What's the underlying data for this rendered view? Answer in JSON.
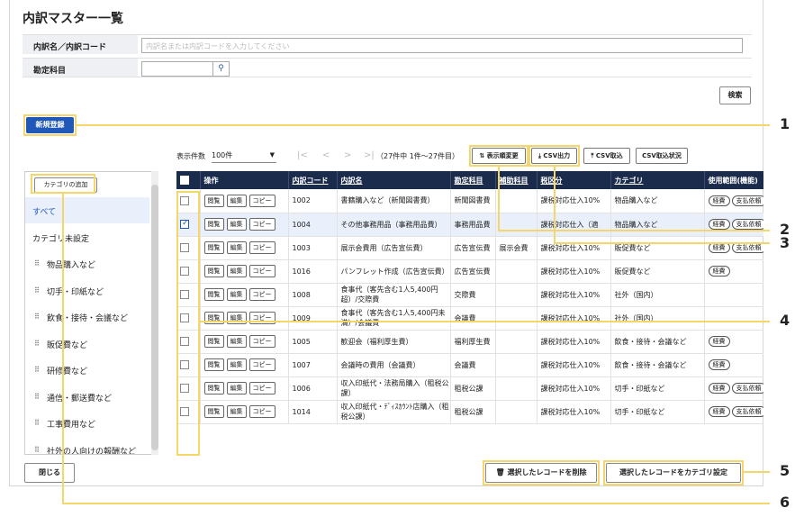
{
  "page": {
    "title": "内訳マスター一覧"
  },
  "filters": {
    "name_label": "内訳名／内訳コード",
    "name_placeholder": "内訳名または内訳コードを入力してください",
    "account_label": "勘定科目",
    "search_button": "検索"
  },
  "new_button": "新規登録",
  "toolbar": {
    "count_label": "表示件数",
    "count_value": "100件",
    "pager_first": "|<",
    "pager_prev": "<",
    "pager_next": ">",
    "pager_last": ">|",
    "range_text": "（27件中 1件～27件目）",
    "reorder_button": "表示順変更",
    "csv_export": "CSV出力",
    "csv_import": "CSV取込",
    "csv_status": "CSV取込状況"
  },
  "categories": {
    "add_button": "カテゴリの追加",
    "items": [
      {
        "label": "すべて",
        "active": true,
        "grip": false
      },
      {
        "label": "カテゴリ未設定",
        "active": false,
        "grip": false
      },
      {
        "label": "物品購入など",
        "active": false,
        "grip": true
      },
      {
        "label": "切手・印紙など",
        "active": false,
        "grip": true
      },
      {
        "label": "飲食・接待・会議など",
        "active": false,
        "grip": true
      },
      {
        "label": "販促費など",
        "active": false,
        "grip": true
      },
      {
        "label": "研修費など",
        "active": false,
        "grip": true
      },
      {
        "label": "通信・郵送費など",
        "active": false,
        "grip": true
      },
      {
        "label": "工事費用など",
        "active": false,
        "grip": true
      },
      {
        "label": "社外の人向けの報酬など",
        "active": false,
        "grip": true
      }
    ]
  },
  "table": {
    "headers": {
      "ops": "操作",
      "code": "内訳コード",
      "name": "内訳名",
      "account": "勘定科目",
      "sub": "補助科目",
      "tax": "税区分",
      "category": "カテゴリ",
      "usage": "使用範囲(機能)"
    },
    "row_buttons": {
      "view": "閲覧",
      "edit": "編集",
      "copy": "コピー"
    },
    "rows": [
      {
        "checked": false,
        "code": "1002",
        "name": "書籍購入など（新聞図書費）",
        "account": "新聞図書費",
        "sub": "",
        "tax": "課税対応仕入10%",
        "category": "物品購入など",
        "usage": [
          "経費",
          "支払依頼"
        ]
      },
      {
        "checked": true,
        "code": "1004",
        "name": "その他事務用品（事務用品費）",
        "account": "事務用品費",
        "sub": "",
        "tax": "課税対応仕入（適",
        "category": "物品購入など",
        "usage": [
          "経費",
          "支払依頼"
        ]
      },
      {
        "checked": false,
        "code": "1003",
        "name": "展示会費用（広告宣伝費）",
        "account": "広告宣伝費",
        "sub": "展示会費",
        "tax": "課税対応仕入10%",
        "category": "販促費など",
        "usage": [
          "経費",
          "支払依頼"
        ]
      },
      {
        "checked": false,
        "code": "1016",
        "name": "パンフレット作成（広告宣伝費）",
        "account": "広告宣伝費",
        "sub": "",
        "tax": "課税対応仕入10%",
        "category": "販促費など",
        "usage": [
          "経費"
        ]
      },
      {
        "checked": false,
        "code": "1008",
        "name": "食事代（客先含む1人5,400円超）/交際費",
        "account": "交際費",
        "sub": "",
        "tax": "課税対応仕入10%",
        "category": "社外（国内）",
        "usage": []
      },
      {
        "checked": false,
        "code": "1009",
        "name": "食事代（客先含む1人5,400円未満）/会議費",
        "account": "会議費",
        "sub": "",
        "tax": "課税対応仕入10%",
        "category": "社外（国内）",
        "usage": []
      },
      {
        "checked": false,
        "code": "1005",
        "name": "歓迎会（福利厚生費）",
        "account": "福利厚生費",
        "sub": "",
        "tax": "課税対応仕入10%",
        "category": "飲食・接待・会議など",
        "usage": [
          "経費"
        ]
      },
      {
        "checked": false,
        "code": "1007",
        "name": "会議時の費用（会議費）",
        "account": "会議費",
        "sub": "",
        "tax": "課税対応仕入10%",
        "category": "飲食・接待・会議など",
        "usage": [
          "経費"
        ]
      },
      {
        "checked": false,
        "code": "1006",
        "name": "収入印紙代・法務局購入（租税公課）",
        "account": "租税公課",
        "sub": "",
        "tax": "課税対応仕入10%",
        "category": "切手・印紙など",
        "usage": [
          "経費",
          "支払依頼"
        ]
      },
      {
        "checked": false,
        "code": "1014",
        "name": "収入印紙代・ﾃﾞｨｽｶｳﾝﾄ店購入（租税公課）",
        "account": "租税公課",
        "sub": "",
        "tax": "課税対応仕入10%",
        "category": "切手・印紙など",
        "usage": [
          "経費",
          "支払依頼"
        ]
      }
    ]
  },
  "footer": {
    "close": "閉じる",
    "delete_selected": "選択したレコードを削除",
    "set_category": "選択したレコードをカテゴリ設定"
  },
  "callouts": [
    "1",
    "2",
    "3",
    "4",
    "5",
    "6"
  ],
  "colors": {
    "accent": "#1f58b8",
    "header": "#1b2b4c",
    "highlight": "#f4d66b"
  }
}
